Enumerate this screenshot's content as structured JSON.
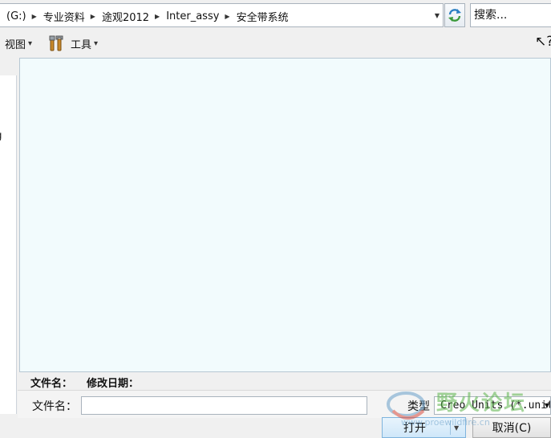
{
  "address_bar": {
    "breadcrumbs": [
      "(G:)",
      "专业资料",
      "途观2012",
      "Inter_assy",
      "安全带系统"
    ]
  },
  "search": {
    "placeholder": "搜索..."
  },
  "toolbar": {
    "view_label": "视图",
    "tools_label": "工具",
    "view_icon": "chevron-down-icon",
    "tools_icon": "tools-icon",
    "help_icon": "help-cursor-icon"
  },
  "left_pane": {
    "partial_text": "ng"
  },
  "file_list": {
    "columns": [
      "文件名：",
      "修改日期："
    ],
    "items": []
  },
  "form": {
    "filename_label": "文件名：",
    "filename_value": "",
    "type_label": "类型",
    "type_value": "Creo Units (*.unit)"
  },
  "buttons": {
    "open_label": "打开",
    "cancel_label": "取消(C)"
  },
  "watermark": {
    "text": "野火论坛",
    "url": "www.proewildfire.cn"
  },
  "colors": {
    "file_area_bg": "#f2fbfd",
    "open_button_bg": "#cfe7f9",
    "refresh_accent": "#2a7fc3"
  }
}
